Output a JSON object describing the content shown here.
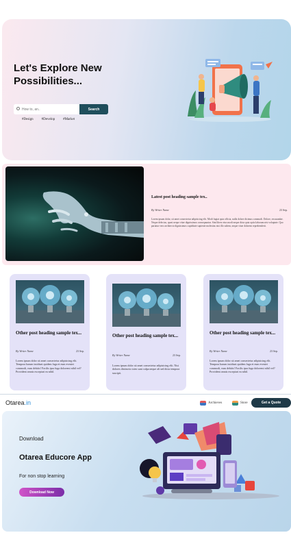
{
  "hero": {
    "title": "Let's Explore New Possibilities...",
    "search_placeholder": "How to, an..",
    "search_button": "Search",
    "tags": [
      "#Design",
      "#Develop",
      "#Market"
    ]
  },
  "latest_post": {
    "heading": "Latest post heading sample tex..",
    "writer": "By Writer Name",
    "date": "23 Sep.",
    "body": "Lorem ipsum dolor, sit amet consectetur adipisicing elit. Modi fugiat quia officia, nulla dolore dicimus commodi. Dolore, recusandae. Neque delectus, quasi neque vitae dignissimos consequuntur. Sint libero eius modi neque dicta quia optio laborum nisi voluptate. Quo pariatur vero architecto dignissimos cupiditate sapiente molestias nisi illo saltem, neque vitae dolorem reprehenderit."
  },
  "cards": [
    {
      "heading": "Other post heading sample tex...",
      "writer": "By Writer Name",
      "date": "23 Sep.",
      "body": "Lorem ipsum dolor sit amet consectetur adipisicing elit. Tempora harum incidunt quidem fuga et eum eveniet commodi, eum debitis! Facilis ipsa fuga doloremi nihil vel? Provident omnis excepturi ea nihil."
    },
    {
      "heading": "Other post heading sample tex...",
      "writer": "By Writer Name",
      "date": "23 Sep.",
      "body": "Lorem ipsum dolor sit amet consectetur adipisicing elit. Nisi dolores distinctio totes sunt culpa neque alt sed dicta tempora suscipit."
    },
    {
      "heading": "Other post heading sample tex...",
      "writer": "By Writer Name",
      "date": "23 Sep.",
      "body": "Lorem ipsum dolor sit amet consectetur adipisicing elit. Tempora harum incidunt quidem fuga et eum eveniet commodi, eum debitis! Facilis ipsa fuga doloremi nihil vel? Provident omnis excepturi ea nihil."
    }
  ],
  "nav": {
    "brand_main": "Otarea",
    "brand_suffix": ".in",
    "archieves": "Archieves",
    "store": "Store",
    "quote_button": "Get a Quote"
  },
  "app": {
    "download_label": "Download",
    "title": "Otarea Educore App",
    "subtitle": "For non stop learning",
    "download_button": "Download Now"
  },
  "colors": {
    "accent": "#1f4e5c",
    "brand_suffix": "#2c8ed8",
    "download_gradient_start": "#d054c8",
    "download_gradient_end": "#7b2ea8"
  }
}
